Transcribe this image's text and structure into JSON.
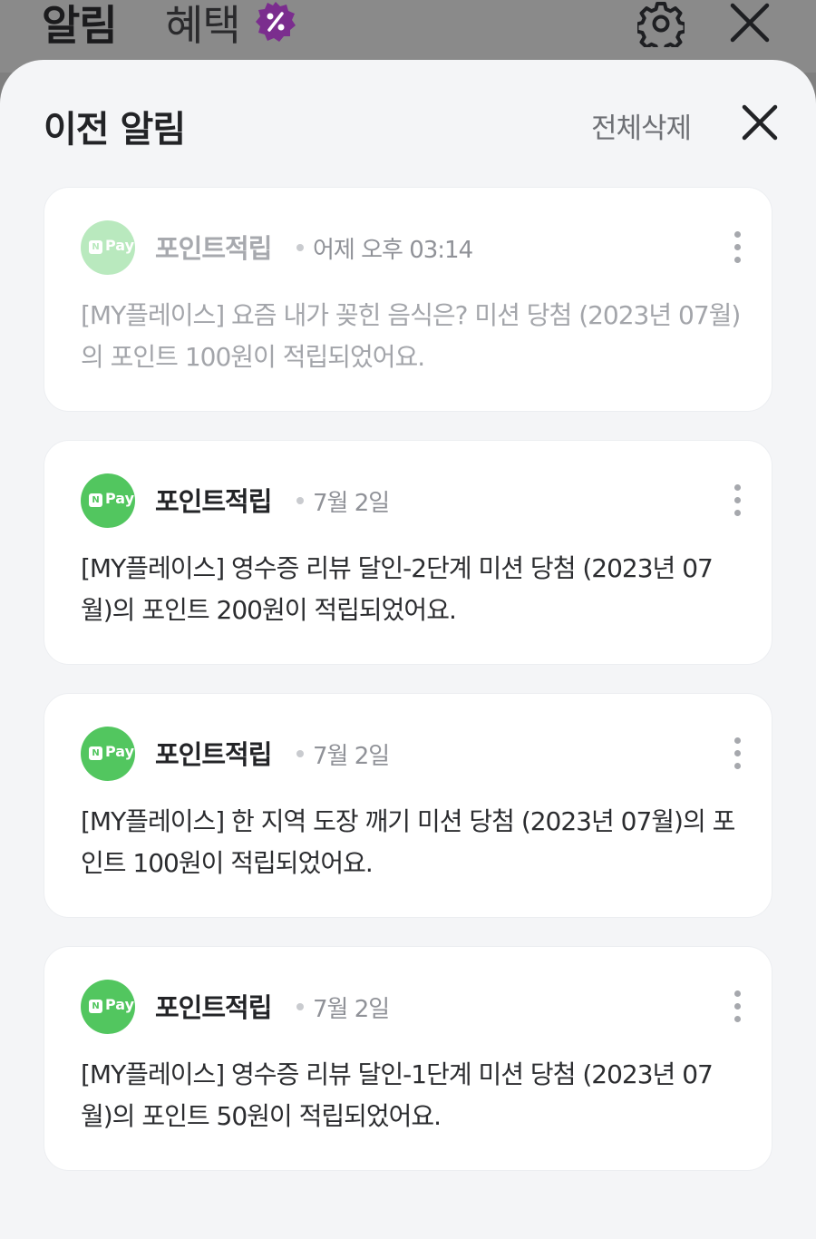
{
  "top_tabs": {
    "alarm": "알림",
    "benefit": "혜택"
  },
  "sheet": {
    "title": "이전 알림",
    "delete_all": "전체삭제"
  },
  "avatar_label": {
    "n": "N",
    "pay": "Pay"
  },
  "colors": {
    "npay_green": "#52c65f",
    "badge_purple": "#7b2d8e"
  },
  "notifications": [
    {
      "sender": "포인트적립",
      "time": "어제 오후 03:14",
      "message": "[MY플레이스] 요즘 내가 꽂힌 음식은? 미션 당첨 (2023년 07월)의 포인트 100원이 적립되었어요.",
      "read": true
    },
    {
      "sender": "포인트적립",
      "time": "7월 2일",
      "message": "[MY플레이스] 영수증 리뷰 달인-2단계 미션 당첨 (2023년 07월)의 포인트 200원이 적립되었어요.",
      "read": false
    },
    {
      "sender": "포인트적립",
      "time": "7월 2일",
      "message": "[MY플레이스] 한 지역 도장 깨기 미션 당첨 (2023년 07월)의 포인트 100원이 적립되었어요.",
      "read": false
    },
    {
      "sender": "포인트적립",
      "time": "7월 2일",
      "message": "[MY플레이스] 영수증 리뷰 달인-1단계 미션 당첨 (2023년 07월)의 포인트 50원이 적립되었어요.",
      "read": false
    }
  ]
}
